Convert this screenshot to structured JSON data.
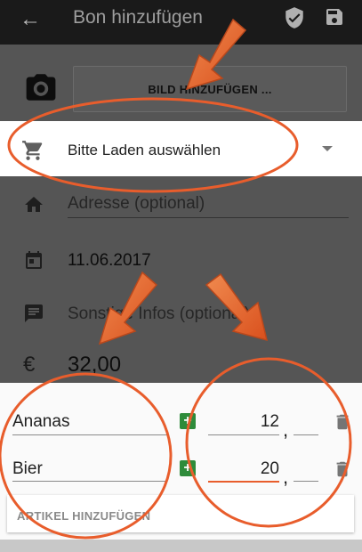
{
  "appbar": {
    "title": "Bon hinzufügen",
    "back_icon": "arrow-back-icon",
    "verify_icon": "shield-check-icon",
    "save_icon": "save-icon"
  },
  "photo": {
    "button_label": "BILD HINZUFÜGEN ..."
  },
  "store": {
    "placeholder": "Bitte Laden auswählen"
  },
  "address": {
    "placeholder": "Adresse (optional)"
  },
  "date": {
    "value": "11.06.2017"
  },
  "other": {
    "placeholder": "Sonstige Infos (optional)"
  },
  "total": {
    "currency": "€",
    "value": "32,00"
  },
  "items": [
    {
      "name": "Ananas",
      "euros": "12",
      "cents": ""
    },
    {
      "name": "Bier",
      "euros": "20",
      "cents": ""
    }
  ],
  "add_article_label": "ARTIKEL HINZUFÜGEN",
  "comma": ",",
  "plus": "+",
  "annotation_color": "#e85d2c"
}
